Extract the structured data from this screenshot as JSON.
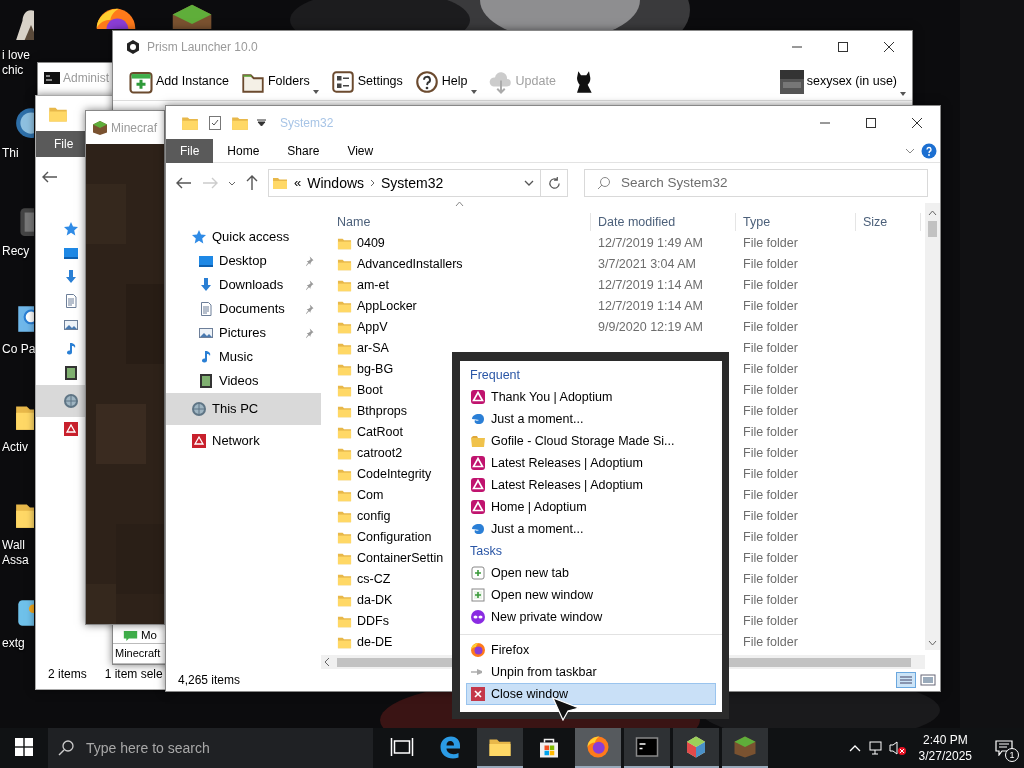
{
  "desktop_icons": [
    {
      "label": "i love chic",
      "kind": "figure"
    },
    {
      "label": "Thi",
      "kind": "globe"
    },
    {
      "label": "Recy",
      "kind": "bin"
    },
    {
      "label": "Co Pa",
      "kind": "panel"
    },
    {
      "label": "Activ",
      "kind": "folder"
    },
    {
      "label": "Wall Assa",
      "kind": "folder"
    },
    {
      "label": "extg",
      "kind": "app"
    }
  ],
  "command_window": {
    "title": "Administ"
  },
  "prism_launcher": {
    "title": "Prism Launcher 10.0",
    "toolbar": [
      {
        "label": "Add Instance",
        "kind": "add",
        "menu": false,
        "disabled": false
      },
      {
        "label": "Folders",
        "kind": "folder",
        "menu": true,
        "disabled": false
      },
      {
        "label": "Settings",
        "kind": "settings",
        "menu": false,
        "disabled": false
      },
      {
        "label": "Help",
        "kind": "help",
        "menu": true,
        "disabled": false
      },
      {
        "label": "Update",
        "kind": "update",
        "menu": false,
        "disabled": true
      }
    ],
    "account": "sexysex (in use)",
    "instance": "Mo",
    "group_tab": "Minecraft"
  },
  "back_explorer": {
    "ribbon_tab": "File",
    "status": [
      "2 items",
      "1 item sele"
    ],
    "nav": [
      {
        "kind": "star",
        "selected": false
      },
      {
        "kind": "desktop",
        "selected": false
      },
      {
        "kind": "download",
        "selected": false
      },
      {
        "kind": "document",
        "selected": false
      },
      {
        "kind": "picture",
        "selected": false
      },
      {
        "kind": "music",
        "selected": false
      },
      {
        "kind": "video",
        "selected": false
      },
      {
        "kind": "pc",
        "selected": true
      },
      {
        "kind": "network",
        "selected": false
      }
    ]
  },
  "minecraft_window": {
    "title": "Minecraf"
  },
  "explorer": {
    "title": "System32",
    "ribbon_tabs": [
      {
        "label": "File",
        "selected": true
      },
      {
        "label": "Home",
        "selected": false
      },
      {
        "label": "Share",
        "selected": false
      },
      {
        "label": "View",
        "selected": false
      }
    ],
    "overflow_marker": "«",
    "breadcrumb": [
      "Windows",
      "System32"
    ],
    "search": {
      "placeholder": "Search System32"
    },
    "nav": [
      {
        "label": "Quick access",
        "kind": "star",
        "selected": false,
        "children": [
          {
            "label": "Desktop",
            "kind": "desktop",
            "pinned": true,
            "selected": false
          },
          {
            "label": "Downloads",
            "kind": "download",
            "pinned": true,
            "selected": false
          },
          {
            "label": "Documents",
            "kind": "document",
            "pinned": true,
            "selected": false
          },
          {
            "label": "Pictures",
            "kind": "picture",
            "pinned": true,
            "selected": false
          },
          {
            "label": "Music",
            "kind": "music",
            "pinned": false,
            "selected": false
          },
          {
            "label": "Videos",
            "kind": "video",
            "pinned": false,
            "selected": false
          }
        ]
      },
      {
        "label": "This PC",
        "kind": "pc",
        "selected": true
      },
      {
        "label": "Network",
        "kind": "network",
        "selected": false
      }
    ],
    "columns": [
      "Name",
      "Date modified",
      "Type",
      "Size"
    ],
    "rows": [
      {
        "name": "0409",
        "date": "12/7/2019 1:49 AM",
        "type": "File folder"
      },
      {
        "name": "AdvancedInstallers",
        "date": "3/7/2021 3:04 AM",
        "type": "File folder"
      },
      {
        "name": "am-et",
        "date": "12/7/2019 1:14 AM",
        "type": "File folder"
      },
      {
        "name": "AppLocker",
        "date": "12/7/2019 1:14 AM",
        "type": "File folder"
      },
      {
        "name": "AppV",
        "date": "9/9/2020 12:19 AM",
        "type": "File folder"
      },
      {
        "name": "ar-SA",
        "type": "File folder"
      },
      {
        "name": "bg-BG",
        "type": "File folder"
      },
      {
        "name": "Boot",
        "type": "File folder"
      },
      {
        "name": "Bthprops",
        "type": "File folder"
      },
      {
        "name": "CatRoot",
        "type": "File folder"
      },
      {
        "name": "catroot2",
        "type": "File folder"
      },
      {
        "name": "CodeIntegrity",
        "type": "File folder"
      },
      {
        "name": "Com",
        "type": "File folder"
      },
      {
        "name": "config",
        "type": "File folder"
      },
      {
        "name": "Configuration",
        "type": "File folder"
      },
      {
        "name": "ContainerSettin",
        "type": "File folder"
      },
      {
        "name": "cs-CZ",
        "type": "File folder"
      },
      {
        "name": "da-DK",
        "type": "File folder"
      },
      {
        "name": "DDFs",
        "type": "File folder"
      },
      {
        "name": "de-DE",
        "type": "File folder"
      }
    ],
    "status": "4,265 items"
  },
  "jump_list": {
    "sections": [
      {
        "heading": "Frequent",
        "items": [
          {
            "label": "Thank You | Adoptium",
            "kind": "adoptium",
            "selected": false
          },
          {
            "label": "Just a moment...",
            "kind": "cloud",
            "selected": false
          },
          {
            "label": "Gofile - Cloud Storage Made Si...",
            "kind": "gofile",
            "selected": false
          },
          {
            "label": "Latest Releases | Adoptium",
            "kind": "adoptium",
            "selected": false
          },
          {
            "label": "Latest Releases | Adoptium",
            "kind": "adoptium",
            "selected": false
          },
          {
            "label": "Home | Adoptium",
            "kind": "adoptium",
            "selected": false
          },
          {
            "label": "Just a moment...",
            "kind": "cloud",
            "selected": false
          }
        ]
      },
      {
        "heading": "Tasks",
        "items": [
          {
            "label": "Open new tab",
            "kind": "newtab",
            "selected": false
          },
          {
            "label": "Open new window",
            "kind": "newwindow",
            "selected": false
          },
          {
            "label": "New private window",
            "kind": "private",
            "selected": false
          }
        ]
      },
      {
        "items": [
          {
            "label": "Firefox",
            "kind": "firefox",
            "selected": false
          },
          {
            "label": "Unpin from taskbar",
            "kind": "unpin",
            "selected": false
          },
          {
            "label": "Close window",
            "kind": "closewin",
            "selected": true
          }
        ]
      }
    ]
  },
  "taskbar": {
    "search_placeholder": "Type here to search",
    "apps": [
      {
        "kind": "taskview",
        "running": false,
        "selected": false
      },
      {
        "kind": "edge",
        "running": false,
        "selected": false
      },
      {
        "kind": "explorer",
        "running": true,
        "selected": false
      },
      {
        "kind": "store",
        "running": false,
        "selected": false
      },
      {
        "kind": "firefox",
        "running": true,
        "selected": true
      },
      {
        "kind": "terminal",
        "running": true,
        "selected": false
      },
      {
        "kind": "prism",
        "running": true,
        "selected": false
      },
      {
        "kind": "minecraft",
        "running": true,
        "selected": false
      }
    ],
    "time": "2:40 PM",
    "date": "3/27/2025",
    "notifications": "1"
  }
}
